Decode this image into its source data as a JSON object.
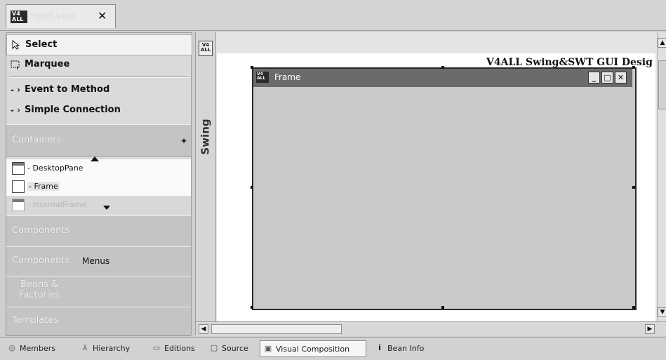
{
  "editor_tab": {
    "logo": "V4\nALL",
    "title": "*test2.v4all",
    "close": "✕"
  },
  "palette": {
    "tools": [
      {
        "label": "Select"
      },
      {
        "label": "Marquee"
      },
      {
        "label": "Event to Method",
        "prefix": "- ›"
      },
      {
        "label": "Simple Connection",
        "prefix": "- ›"
      }
    ],
    "drawers": {
      "swing": "Containers",
      "components": "Components",
      "components_menus_faded": "Components",
      "components_menus_bold": "Menus",
      "beans": "Beans &\nFactories",
      "templates": "Templates"
    },
    "list_items": [
      {
        "label": "- DesktopPane"
      },
      {
        "label": "- Frame"
      },
      {
        "label": "- InternalFrame"
      }
    ]
  },
  "canvas": {
    "rail_logo": "V4\nALL",
    "rail_label": "Swing",
    "design_title": "V4ALL Swing&SWT GUI Desig",
    "frame": {
      "logo": "V4\nALL",
      "title": "Frame",
      "buttons": [
        "_",
        "□",
        "✕"
      ]
    }
  },
  "bottom_tabs": [
    {
      "icon": "◎",
      "label": "Members"
    },
    {
      "icon": "⅄",
      "label": "Hierarchy"
    },
    {
      "icon": "▭",
      "label": "Editions"
    },
    {
      "icon": "▢",
      "label": "Source"
    },
    {
      "icon": "▣",
      "label": "Visual Composition",
      "active": true
    },
    {
      "icon": "i",
      "label": "Bean Info"
    }
  ]
}
